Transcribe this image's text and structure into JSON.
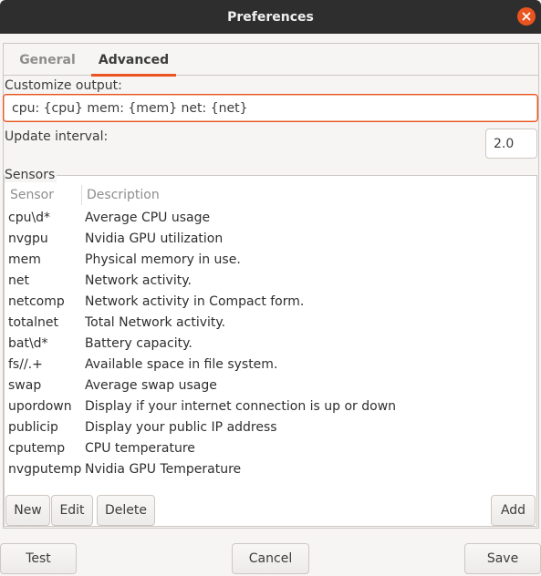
{
  "window": {
    "title": "Preferences"
  },
  "tabs": [
    {
      "label": "General",
      "active": false
    },
    {
      "label": "Advanced",
      "active": true
    }
  ],
  "customize": {
    "label": "Customize output:",
    "value": "cpu: {cpu} mem: {mem} net: {net}"
  },
  "interval": {
    "label": "Update interval:",
    "value": "2.0"
  },
  "sensors": {
    "label": "Sensors",
    "columns": {
      "sensor": "Sensor",
      "description": "Description"
    },
    "rows": [
      {
        "sensor": "cpu\\d*",
        "description": "Average CPU usage"
      },
      {
        "sensor": "nvgpu",
        "description": "Nvidia GPU utilization"
      },
      {
        "sensor": "mem",
        "description": "Physical memory in use."
      },
      {
        "sensor": "net",
        "description": "Network activity."
      },
      {
        "sensor": "netcomp",
        "description": "Network activity in Compact form."
      },
      {
        "sensor": "totalnet",
        "description": "Total Network activity."
      },
      {
        "sensor": "bat\\d*",
        "description": "Battery capacity."
      },
      {
        "sensor": "fs//.+",
        "description": "Available space in file system."
      },
      {
        "sensor": "swap",
        "description": "Average swap usage"
      },
      {
        "sensor": "upordown",
        "description": "Display if your internet connection is up or down"
      },
      {
        "sensor": "publicip",
        "description": "Display your public IP address"
      },
      {
        "sensor": "cputemp",
        "description": "CPU temperature"
      },
      {
        "sensor": "nvgputemp",
        "description": "Nvidia GPU Temperature"
      }
    ],
    "buttons": {
      "new": "New",
      "edit": "Edit",
      "delete": "Delete",
      "add": "Add"
    }
  },
  "footer": {
    "test": "Test",
    "cancel": "Cancel",
    "save": "Save"
  },
  "colors": {
    "accent": "#e95420",
    "titlebar": "#2e2e2e",
    "background": "#f6f5f4"
  },
  "icons": {
    "close": "close-icon"
  }
}
